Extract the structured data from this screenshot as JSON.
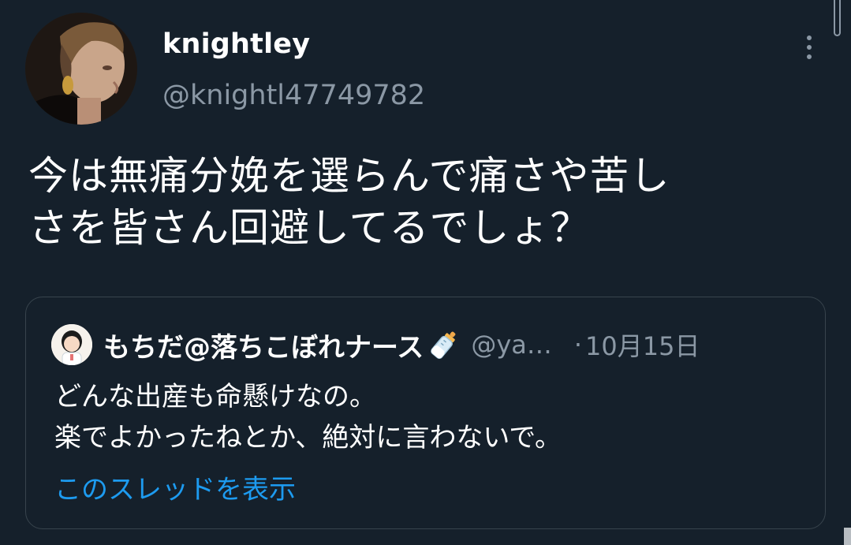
{
  "tweet": {
    "author": {
      "display_name": "knightley",
      "handle": "@knightl47749782"
    },
    "text_lines": [
      "今は無痛分娩を選らんで痛さや苦し",
      "さを皆さん回避してるでしょ？"
    ]
  },
  "quoted_tweet": {
    "author": {
      "display_name": "もちだ@落ちこぼれナース",
      "name_emoji": "baby-bottle-icon",
      "handle": "@ya…"
    },
    "separator": "·",
    "date": "10月15日",
    "text_lines": [
      "どんな出産も命懸けなの。",
      "楽でよかったねとか、絶対に言わないで。"
    ],
    "show_thread_label": "このスレッドを表示"
  },
  "icons": {
    "more": "more-vertical-icon"
  },
  "colors": {
    "background": "#15202b",
    "secondary_text": "#8b98a5",
    "link": "#1d9bf0",
    "card_border": "#38444d"
  }
}
